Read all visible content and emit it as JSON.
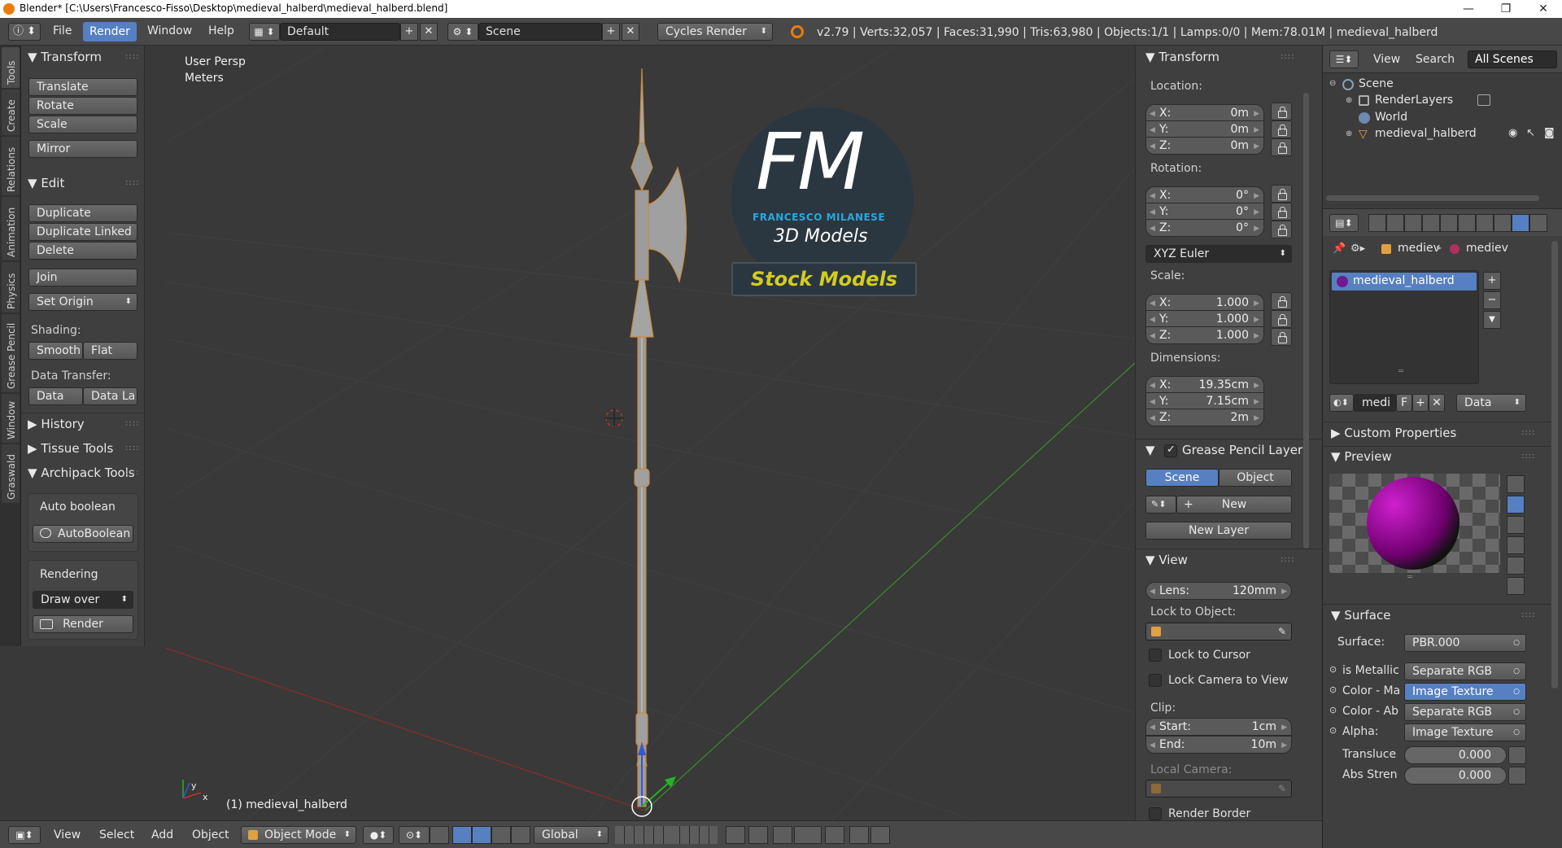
{
  "window": {
    "title": "Blender* [C:\\Users\\Francesco-Fisso\\Desktop\\medieval_halberd\\medieval_halberd.blend]",
    "minimize": "—",
    "maximize": "❐",
    "close": "✕"
  },
  "info": {
    "menus": [
      "File",
      "Render",
      "Window",
      "Help"
    ],
    "active_menu": "Render",
    "layout": "Default",
    "scene": "Scene",
    "engine": "Cycles Render",
    "stats": "v2.79 | Verts:32,057 | Faces:31,990 | Tris:63,980 | Objects:1/1 | Lamps:0/0 | Mem:78.01M | medieval_halberd"
  },
  "toolshelf": {
    "tabs": [
      "Tools",
      "Create",
      "Relations",
      "Animation",
      "Physics",
      "Grease Pencil",
      "Window",
      "Graswald"
    ],
    "transform": {
      "title": "Transform",
      "buttons": [
        "Translate",
        "Rotate",
        "Scale",
        "Mirror"
      ]
    },
    "edit": {
      "title": "Edit",
      "buttons": [
        "Duplicate",
        "Duplicate Linked",
        "Delete",
        "Join"
      ],
      "set_origin": "Set Origin",
      "shading_label": "Shading:",
      "smooth": "Smooth",
      "flat": "Flat",
      "data_transfer_label": "Data Transfer:",
      "data": "Data",
      "data_la": "Data La"
    },
    "history": "History",
    "tissue": "Tissue Tools",
    "archipack": "Archipack Tools",
    "auto_boolean_label": "Auto boolean",
    "auto_boolean_btn": "AutoBoolean",
    "rendering_label": "Rendering",
    "draw_over": "Draw over",
    "render_btn": "Render"
  },
  "viewport": {
    "view_name": "User Persp",
    "units": "Meters",
    "object_label": "(1) medieval_halberd",
    "logo_letters": "FM",
    "logo_name": "FRANCESCO MILANESE",
    "logo_sub": "3D Models",
    "logo_banner": "Stock Models",
    "axis_y": "y",
    "axis_x": "x"
  },
  "npanel": {
    "transform_title": "Transform",
    "location_label": "Location:",
    "location": [
      {
        "k": "X:",
        "v": "0m"
      },
      {
        "k": "Y:",
        "v": "0m"
      },
      {
        "k": "Z:",
        "v": "0m"
      }
    ],
    "rotation_label": "Rotation:",
    "rotation": [
      {
        "k": "X:",
        "v": "0°"
      },
      {
        "k": "Y:",
        "v": "0°"
      },
      {
        "k": "Z:",
        "v": "0°"
      }
    ],
    "rotation_mode": "XYZ Euler",
    "scale_label": "Scale:",
    "scale": [
      {
        "k": "X:",
        "v": "1.000"
      },
      {
        "k": "Y:",
        "v": "1.000"
      },
      {
        "k": "Z:",
        "v": "1.000"
      }
    ],
    "dimensions_label": "Dimensions:",
    "dimensions": [
      {
        "k": "X:",
        "v": "19.35cm"
      },
      {
        "k": "Y:",
        "v": "7.15cm"
      },
      {
        "k": "Z:",
        "v": "2m"
      }
    ],
    "gp_title": "Grease Pencil Layer",
    "gp_scene": "Scene",
    "gp_object": "Object",
    "gp_new": "New",
    "gp_new_layer": "New Layer",
    "view_title": "View",
    "lens_k": "Lens:",
    "lens_v": "120mm",
    "lock_obj_label": "Lock to Object:",
    "lock_cursor": "Lock to Cursor",
    "lock_camera": "Lock Camera to View",
    "clip_label": "Clip:",
    "clip_start_k": "Start:",
    "clip_start_v": "1cm",
    "clip_end_k": "End:",
    "clip_end_v": "10m",
    "local_camera": "Local Camera:",
    "render_border": "Render Border"
  },
  "outliner": {
    "view": "View",
    "search": "Search",
    "filter": "All Scenes",
    "items": [
      "Scene",
      "RenderLayers",
      "World",
      "medieval_halberd"
    ]
  },
  "properties": {
    "crumb1": "mediev",
    "crumb2": "mediev",
    "material_slot": "medieval_halberd",
    "mat_name": "medi",
    "mat_f": "F",
    "mat_link": "Data",
    "custom_props": "Custom Properties",
    "preview": "Preview",
    "surface_title": "Surface",
    "surface_label": "Surface:",
    "surface_value": "PBR.000",
    "inputs": [
      {
        "k": "is Metallic",
        "v": "Separate RGB"
      },
      {
        "k": "Color - Ma",
        "v": "Image Texture"
      },
      {
        "k": "Color - Ab",
        "v": "Separate RGB"
      },
      {
        "k": "Alpha:",
        "v": "Image Texture"
      }
    ],
    "transluce_k": "Transluce",
    "transluce_v": "0.000",
    "abs_k": "Abs Stren",
    "abs_v": "0.000"
  },
  "bottombar": {
    "view": "View",
    "select": "Select",
    "add": "Add",
    "object": "Object",
    "mode": "Object Mode",
    "orientation": "Global"
  },
  "colors": {
    "accent": "#5680c2",
    "panel": "#3f3f3f",
    "viewport": "#393939",
    "header": "#484848"
  }
}
